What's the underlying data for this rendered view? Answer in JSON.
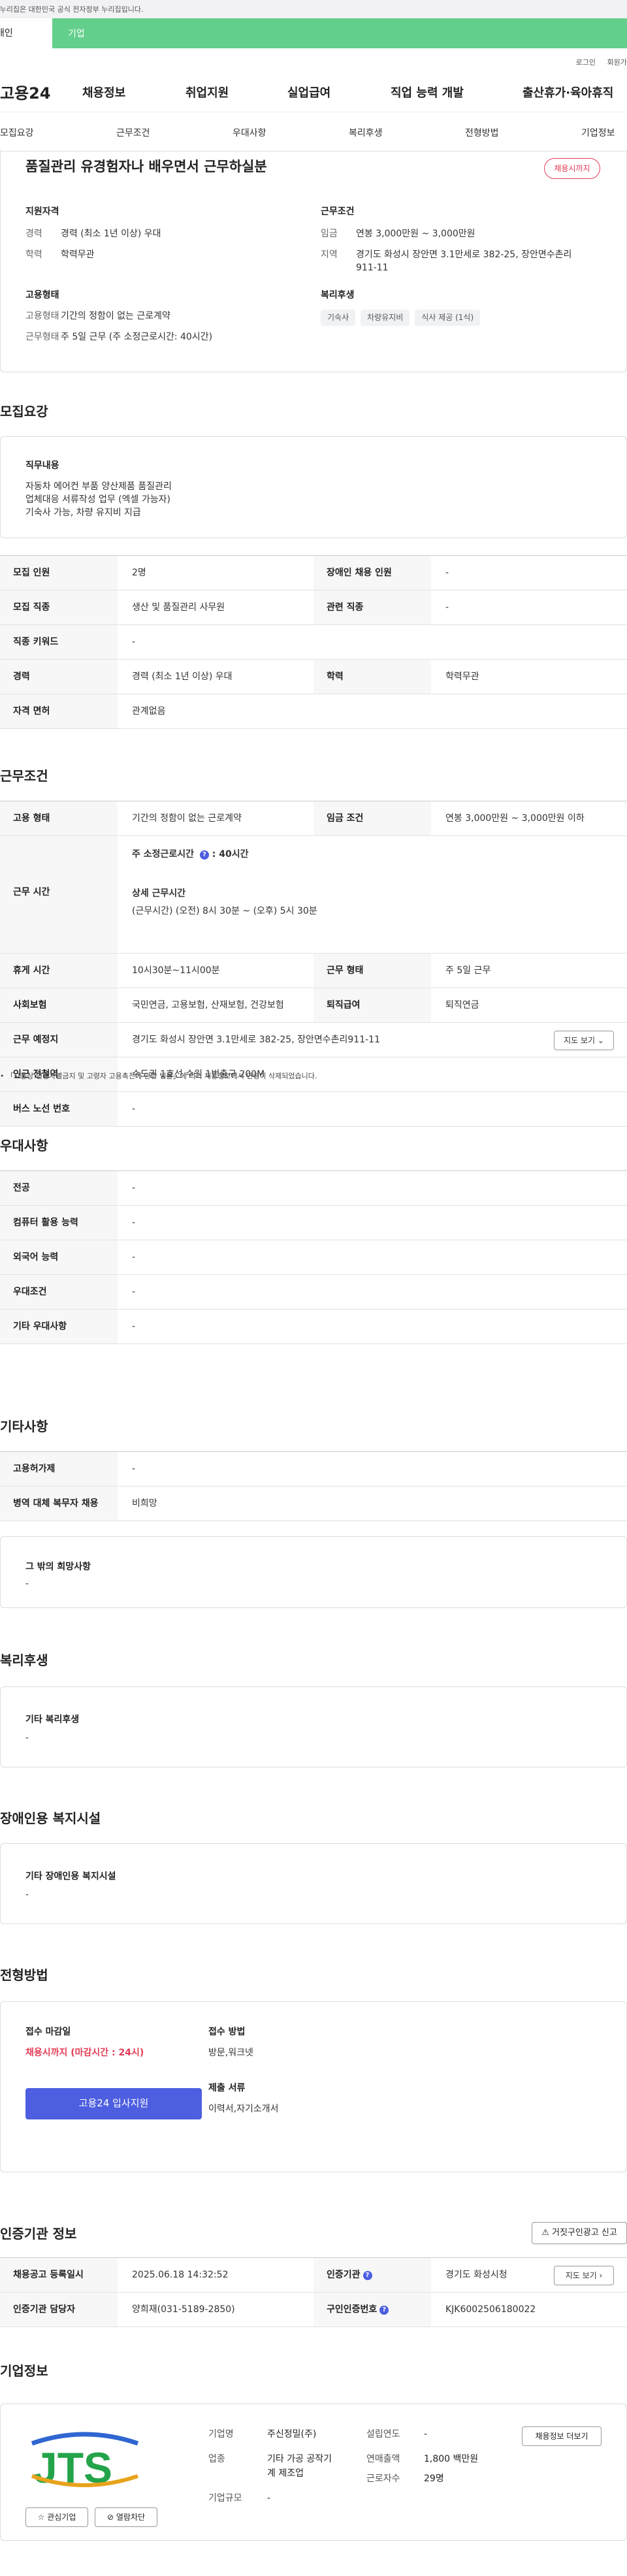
{
  "topbar": {
    "notice": "이 누리집은 대한민국 공식 전자정부 누리집입니다."
  },
  "tabs": {
    "personal": "개인",
    "company": "기업"
  },
  "util": {
    "login": "로그인",
    "join": "회원가입"
  },
  "gnb": {
    "logo": "고용24",
    "items": [
      "채용정보",
      "취업지원",
      "실업급여",
      "직업 능력 개발",
      "출산휴가·육아휴직"
    ]
  },
  "subnav": [
    "모집요강",
    "근무조건",
    "우대사항",
    "복리후생",
    "전형방법",
    "기업정보"
  ],
  "job": {
    "title": "품질관리 유경험자나 배우면서 근무하실분",
    "dday": "채용시까지",
    "qual_h": "지원자격",
    "work_h": "근무조건",
    "emp_h": "고용형태",
    "welfare_h": "복리후생",
    "qual": [
      {
        "k": "경력",
        "v": "경력 (최소 1년 이상) 우대"
      },
      {
        "k": "학력",
        "v": "학력무관"
      }
    ],
    "work": [
      {
        "k": "임금",
        "v": "연봉 3,000만원 ~ 3,000만원"
      },
      {
        "k": "지역",
        "v": "경기도 화성시 장안면 3.1만세로 382-25, 장안면수촌리911-11"
      }
    ],
    "emp": [
      {
        "k": "고용형태",
        "v": "기간의 정함이 없는 근로계약"
      },
      {
        "k": "근무형태",
        "v": "주 5일 근무 (주 소정근로시간: 40시간)"
      }
    ],
    "welfare": [
      "기숙사",
      "차량유지비",
      "식사 제공 (1식)"
    ]
  },
  "recruit": {
    "title": "모집요강",
    "duty_h": "직무내용",
    "duty": [
      "자동차 에어컨 부품 양산제품 품질관리",
      "업체대응 서류작성 업무 (엑셀 가능자)",
      "기숙사 가능, 차량 유지비 지급"
    ],
    "rows": [
      {
        "k1": "모집 인원",
        "v1": "2명",
        "k2": "장애인 채용 인원",
        "v2": "-"
      },
      {
        "k1": "모집 직종",
        "v1": "생산 및 품질관리 사무원",
        "k2": "관련 직종",
        "v2": "-"
      },
      {
        "k": "직종 키워드",
        "v": "-"
      },
      {
        "k1": "경력",
        "v1": "경력 (최소 1년 이상) 우대",
        "k2": "학력",
        "v2": "학력무관"
      },
      {
        "k": "자격 면허",
        "v": "관계없음"
      }
    ]
  },
  "cond": {
    "title": "근무조건",
    "r1": {
      "k1": "고용 형태",
      "v1": "기간의 정함이 없는 근로계약",
      "k2": "임금 조건",
      "v2": "연봉 3,000만원 ~ 3,000만원 이하"
    },
    "hours_k": "근무 시간",
    "hours_main": "주 소정근로시간",
    "hours_val": "40시간",
    "hours_detail_h": "상세 근무시간",
    "hours_detail": "(근무시간) (오전) 8시 30분 ~ (오후) 5시 30분",
    "r3": {
      "k1": "휴게 시간",
      "v1": "10시30분~11시00분",
      "k2": "근무 형태",
      "v2": "주 5일 근무"
    },
    "r4": {
      "k1": "사회보험",
      "v1": "국민연금, 고용보험, 산재보험, 건강보험",
      "k2": "퇴직급여",
      "v2": "퇴직연금"
    },
    "place_k": "근무 예정지",
    "place_v": "경기도 화성시 장안면 3.1만세로 382-25, 장안면수촌리911-11",
    "map_btn": "지도 보기",
    "subway_k": "인근 전철역",
    "subway_v": "수도권 1호선 수원 1번출구 200M",
    "bus_k": "버스 노선 번호",
    "bus_v": "-",
    "note": "「고용상 연령차별금지 및 고령자 고용촉진에 관한 법률」에 의거 채용정보에서 연령이 삭제되었습니다."
  },
  "pref": {
    "title": "우대사항",
    "rows": [
      {
        "k": "전공",
        "v": "-"
      },
      {
        "k": "컴퓨터 활용 능력",
        "v": "-"
      },
      {
        "k": "외국어 능력",
        "v": "-"
      },
      {
        "k": "우대조건",
        "v": "-"
      },
      {
        "k": "기타 우대사항",
        "v": "-"
      }
    ]
  },
  "etc": {
    "title": "기타사항",
    "rows": [
      {
        "k": "고용허가제",
        "v": "-"
      },
      {
        "k": "병역 대체 복무자 채용",
        "v": "비희망"
      }
    ],
    "wish_h": "그 밖의 희망사항",
    "wish_v": "-"
  },
  "welfare": {
    "title": "복리후생",
    "h": "기타 복리후생",
    "v": "-"
  },
  "disabled": {
    "title": "장애인용 복지시설",
    "h": "기타 장애인용 복지시설",
    "v": "-"
  },
  "screening": {
    "title": "전형방법",
    "deadline_h": "접수 마감일",
    "deadline_v": "채용시까지 (마감시간 : 24시)",
    "method_h": "접수 방법",
    "method_v": "방문,워크넷",
    "docs_h": "제출 서류",
    "docs_v": "이력서,자기소개서",
    "apply": "고용24 입사지원"
  },
  "cert": {
    "title": "인증기관 정보",
    "report": "거짓구인광고 신고",
    "r1": {
      "k1": "채용공고 등록일시",
      "v1": "2025.06.18 14:32:52",
      "k2": "인증기관",
      "v2": "경기도 화성시청"
    },
    "r2": {
      "k1": "인증기관 담당자",
      "v1": "양희재(031-5189-2850)",
      "k2": "구인인증번호",
      "v2": "KJK6002506180022"
    },
    "map_btn": "지도 보기"
  },
  "company": {
    "title": "기업정보",
    "logo_text": "JTS",
    "fav": "관심기업",
    "block": "열람차단",
    "more": "채용정보 더보기",
    "name_k": "기업명",
    "name_v": "주신정밀(주)",
    "ind_k": "업종",
    "ind_v1": "기타 가공 공작기",
    "ind_v2": "계 제조업",
    "size_k": "기업규모",
    "size_v": "-",
    "est_k": "설립연도",
    "est_v": "-",
    "sales_k": "연매출액",
    "sales_v": "1,800 백만원",
    "emp_k": "근로자수",
    "emp_v": "29명"
  }
}
